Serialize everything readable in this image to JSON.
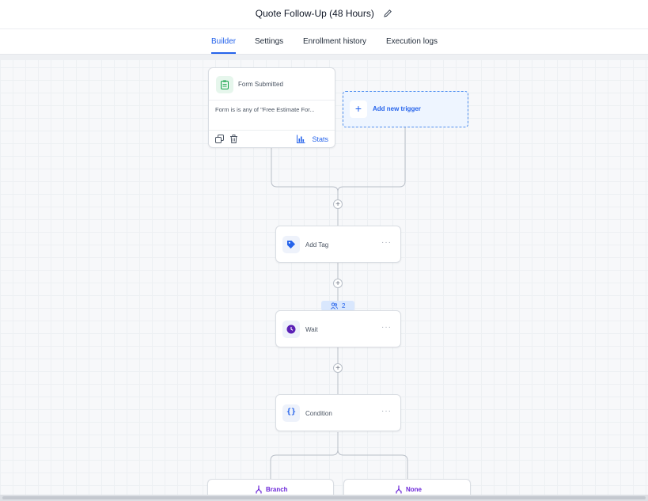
{
  "header": {
    "title": "Quote Follow-Up (48 Hours)",
    "edit_icon": "pencil-icon"
  },
  "tabs": [
    {
      "label": "Builder",
      "active": true
    },
    {
      "label": "Settings",
      "active": false
    },
    {
      "label": "Enrollment history",
      "active": false
    },
    {
      "label": "Execution logs",
      "active": false
    }
  ],
  "trigger": {
    "title": "Form Submitted",
    "description": "Form is is any of \"Free Estimate For...",
    "stats_label": "Stats",
    "icon": "clipboard-icon"
  },
  "add_trigger": {
    "label": "Add new trigger",
    "icon": "plus-icon"
  },
  "steps": [
    {
      "label": "Add Tag",
      "icon": "tag-icon",
      "more": "···"
    },
    {
      "label": "Wait",
      "icon": "clock-icon",
      "more": "···"
    },
    {
      "label": "Condition",
      "icon": "braces-icon",
      "icon_text": "{}",
      "more": "···"
    }
  ],
  "wait_counter": {
    "value": "2",
    "icon": "users-icon"
  },
  "branches": [
    {
      "label": "Branch",
      "icon": "branch-icon"
    },
    {
      "label": "None",
      "icon": "branch-icon"
    }
  ],
  "plus_symbol": "+",
  "colors": {
    "accent": "#2563eb",
    "tag": "#2563eb",
    "wait": "#5b21b6",
    "branch": "#6d28d9",
    "trigger_icon": "#16a34a"
  }
}
